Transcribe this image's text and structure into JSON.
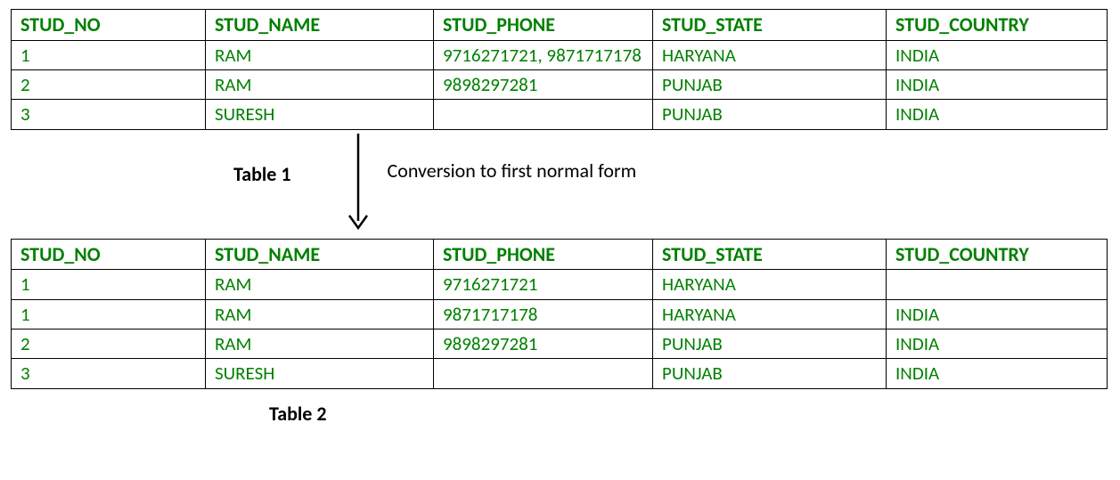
{
  "headers": {
    "col1": "STUD_NO",
    "col2": "STUD_NAME",
    "col3": "STUD_PHONE",
    "col4": "STUD_STATE",
    "col5": "STUD_COUNTRY"
  },
  "table1": {
    "label": "Table 1",
    "rows": [
      {
        "no": "1",
        "name": "RAM",
        "phone": "9716271721, 9871717178",
        "state": "HARYANA",
        "country": "INDIA"
      },
      {
        "no": "2",
        "name": "RAM",
        "phone": "9898297281",
        "state": "PUNJAB",
        "country": "INDIA"
      },
      {
        "no": "3",
        "name": "SURESH",
        "phone": "",
        "state": "PUNJAB",
        "country": "INDIA"
      }
    ]
  },
  "conversion_label": "Conversion to first normal form",
  "table2": {
    "label": "Table 2",
    "rows": [
      {
        "no": "1",
        "name": "RAM",
        "phone": "9716271721",
        "state": "HARYANA",
        "country": ""
      },
      {
        "no": "1",
        "name": "RAM",
        "phone": "9871717178",
        "state": "HARYANA",
        "country": "INDIA"
      },
      {
        "no": "2",
        "name": "RAM",
        "phone": "9898297281",
        "state": "PUNJAB",
        "country": "INDIA"
      },
      {
        "no": "3",
        "name": "SURESH",
        "phone": "",
        "state": "PUNJAB",
        "country": "INDIA"
      }
    ]
  }
}
